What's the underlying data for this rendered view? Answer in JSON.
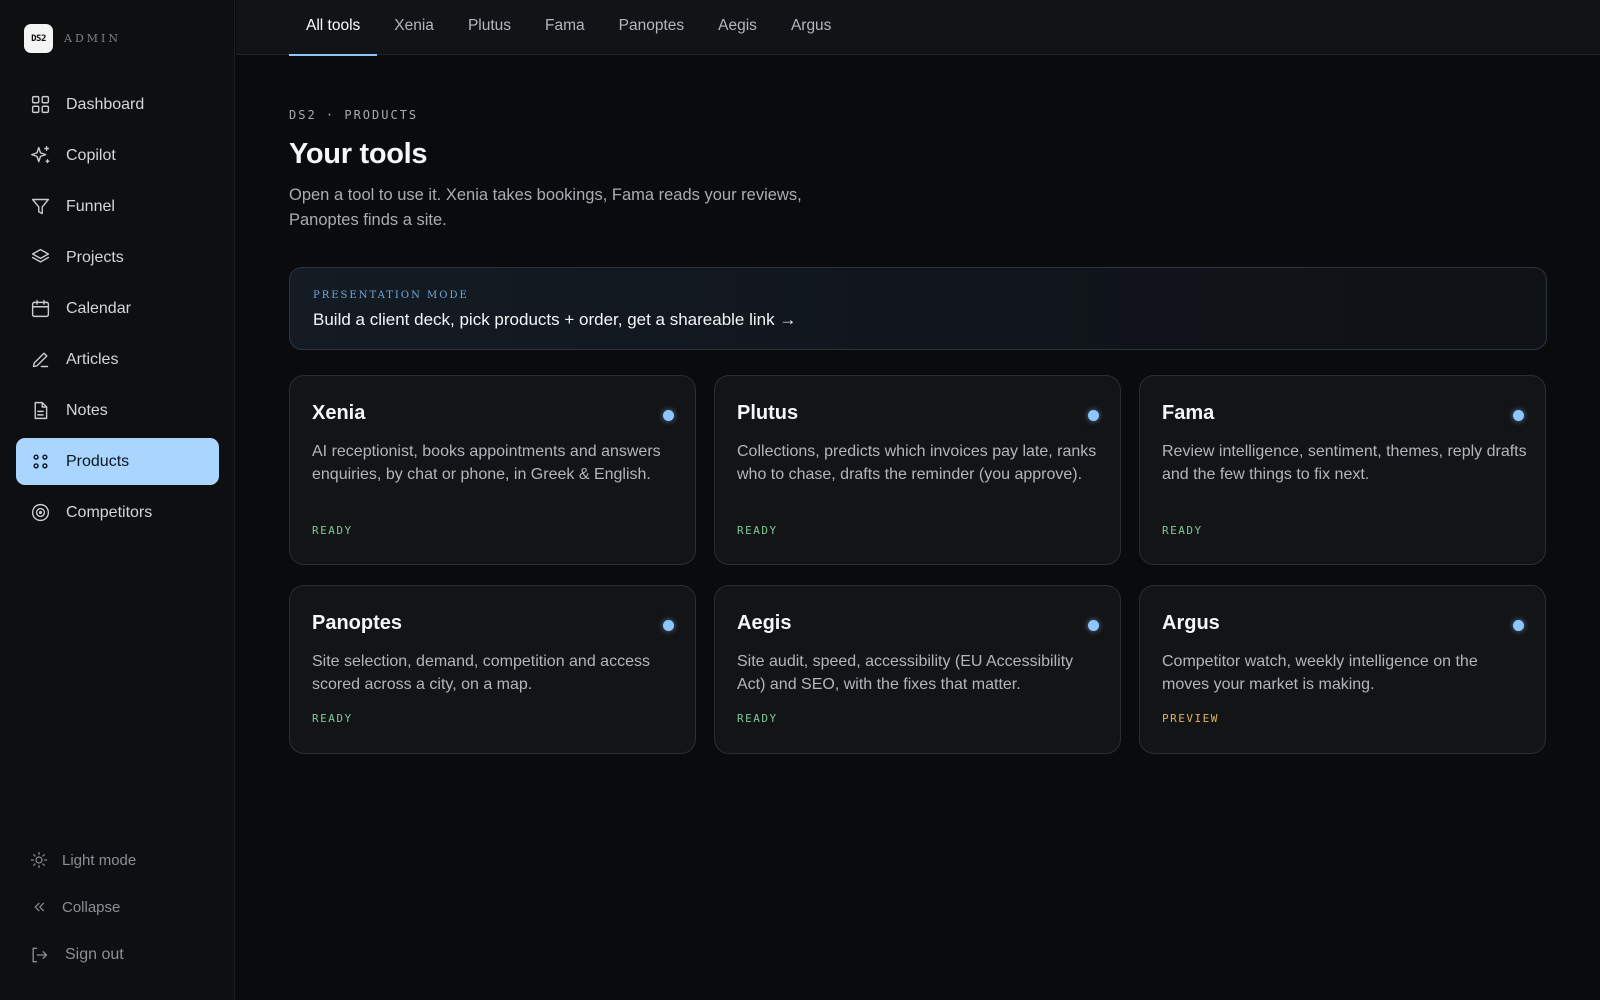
{
  "brand": {
    "logo_text": "DS2",
    "label": "ADMIN"
  },
  "sidebar": {
    "items": [
      {
        "label": "Dashboard",
        "icon": "grid-icon"
      },
      {
        "label": "Copilot",
        "icon": "sparkle-icon"
      },
      {
        "label": "Funnel",
        "icon": "funnel-icon"
      },
      {
        "label": "Projects",
        "icon": "layers-icon"
      },
      {
        "label": "Calendar",
        "icon": "calendar-icon"
      },
      {
        "label": "Articles",
        "icon": "pen-icon"
      },
      {
        "label": "Notes",
        "icon": "document-icon"
      },
      {
        "label": "Products",
        "icon": "dots-grid-icon",
        "active": true
      },
      {
        "label": "Competitors",
        "icon": "target-icon"
      }
    ],
    "bottom": {
      "light_mode": "Light mode",
      "collapse": "Collapse",
      "sign_out": "Sign out"
    }
  },
  "tabs": [
    {
      "label": "All tools",
      "active": true
    },
    {
      "label": "Xenia"
    },
    {
      "label": "Plutus"
    },
    {
      "label": "Fama"
    },
    {
      "label": "Panoptes"
    },
    {
      "label": "Aegis"
    },
    {
      "label": "Argus"
    }
  ],
  "main": {
    "eyebrow": "DS2 · PRODUCTS",
    "title": "Your tools",
    "subtitle": "Open a tool to use it. Xenia takes bookings, Fama reads your reviews, Panoptes finds a site."
  },
  "promo": {
    "eyebrow": "PRESENTATION MODE",
    "text": "Build a client deck, pick products + order, get a shareable link →"
  },
  "cards": [
    {
      "name": "Xenia",
      "description": "AI receptionist, books appointments and answers enquiries, by chat or phone, in Greek & English.",
      "status": "READY"
    },
    {
      "name": "Plutus",
      "description": "Collections, predicts which invoices pay late, ranks who to chase, drafts the reminder (you approve).",
      "status": "READY"
    },
    {
      "name": "Fama",
      "description": "Review intelligence, sentiment, themes, reply drafts and the few things to fix next.",
      "status": "READY"
    },
    {
      "name": "Panoptes",
      "description": "Site selection, demand, competition and access scored across a city, on a map.",
      "status": "READY"
    },
    {
      "name": "Aegis",
      "description": "Site audit, speed, accessibility (EU Accessibility Act) and SEO, with the fixes that matter.",
      "status": "READY"
    },
    {
      "name": "Argus",
      "description": "Competitor watch, weekly intelligence on the moves your market is making.",
      "status": "PREVIEW"
    }
  ],
  "colors": {
    "accent": "#8cc8ff",
    "active_nav": "#a9d5ff",
    "ready": "#7fc79a",
    "preview": "#e0b35a"
  }
}
